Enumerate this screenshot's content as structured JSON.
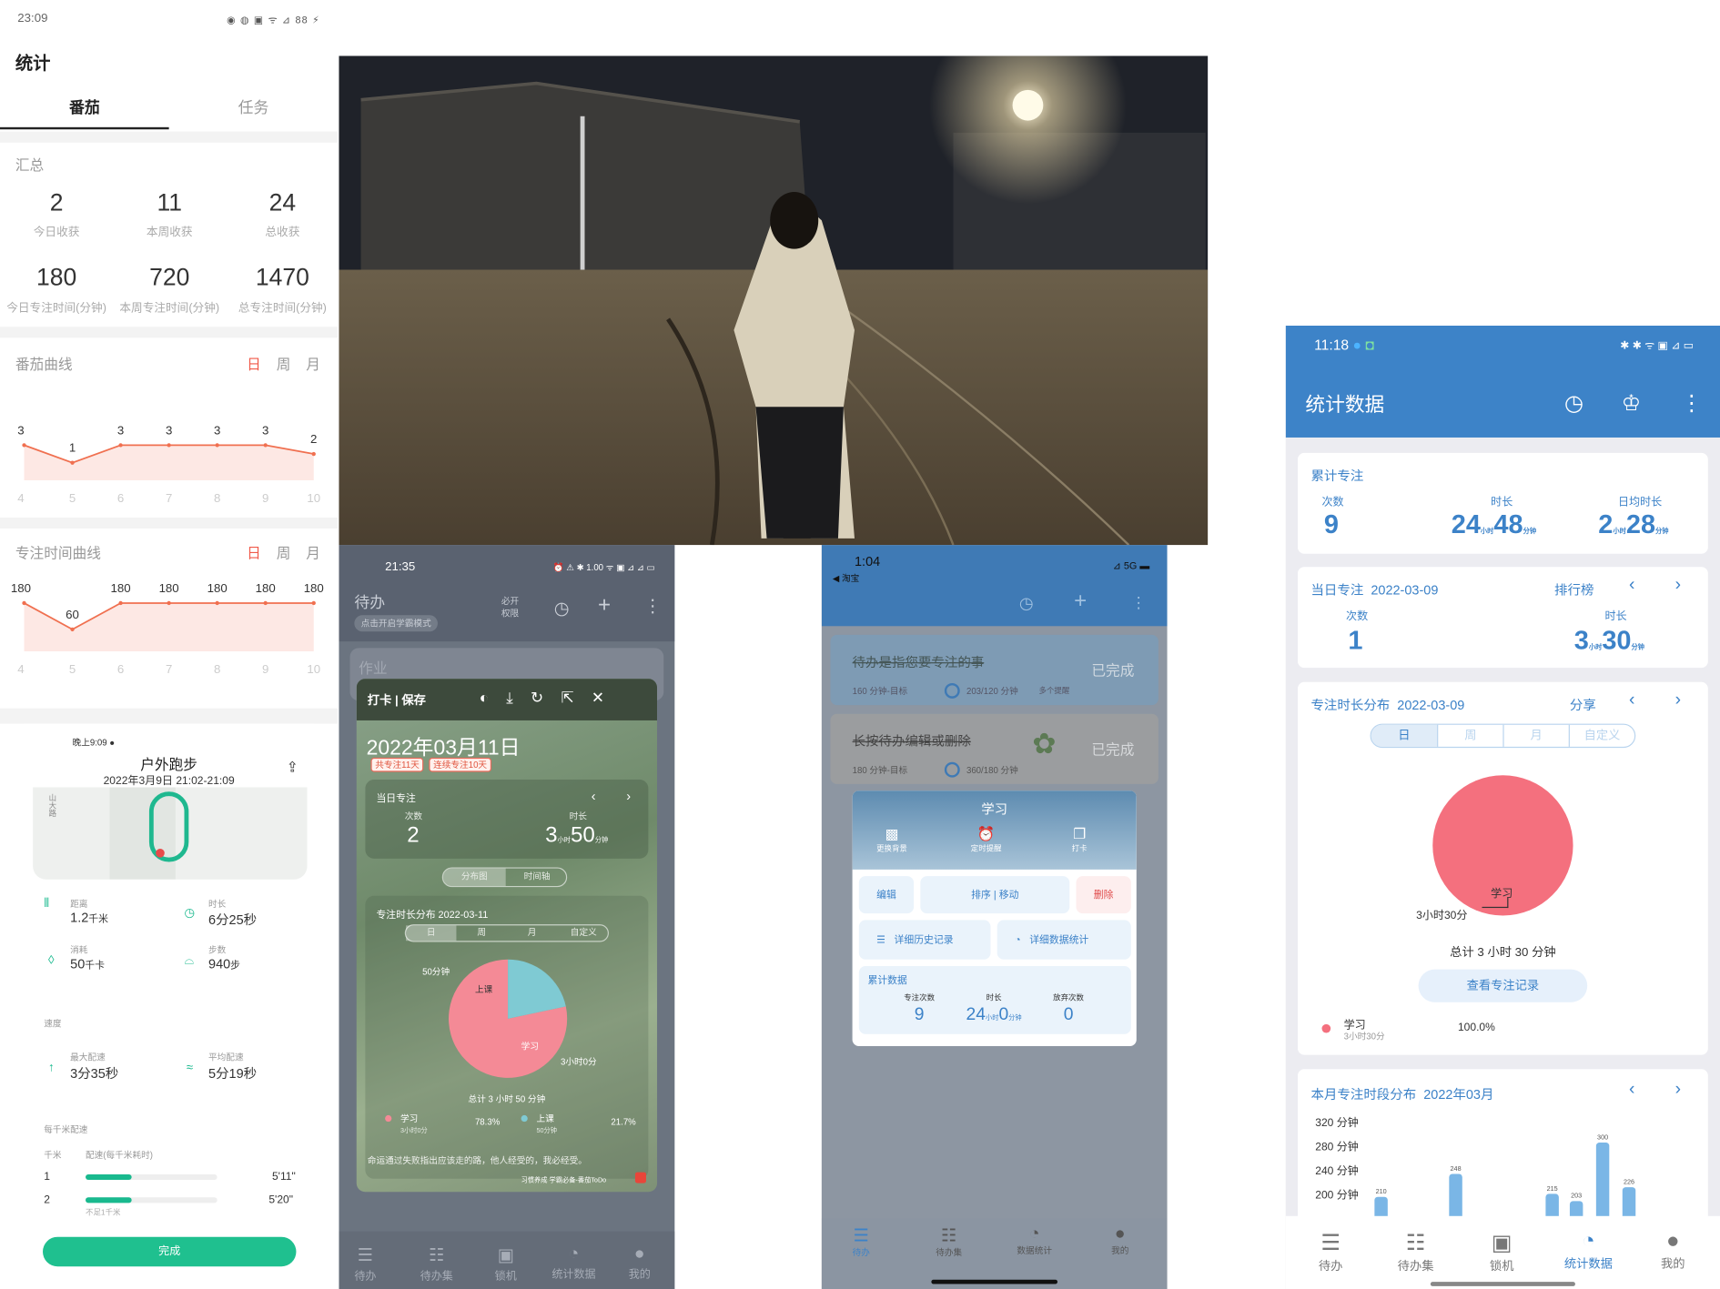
{
  "p1": {
    "time": "23:09",
    "status_icons": "◉ ◍ ▣ ᯤ ⊿ 88 ⚡",
    "title": "统计",
    "tabs": [
      "番茄",
      "任务"
    ],
    "summary_title": "汇总",
    "stats": [
      {
        "v": "2",
        "l": "今日收获"
      },
      {
        "v": "11",
        "l": "本周收获"
      },
      {
        "v": "24",
        "l": "总收获"
      },
      {
        "v": "180",
        "l": "今日专注时间(分钟)"
      },
      {
        "v": "720",
        "l": "本周专注时间(分钟)"
      },
      {
        "v": "1470",
        "l": "总专注时间(分钟)"
      }
    ],
    "curve1_title": "番茄曲线",
    "curve2_title": "专注时间曲线",
    "dwm": [
      "日",
      "周",
      "月"
    ],
    "run": {
      "time": "晚上9:09 ●",
      "title": "户外跑步",
      "date": "2022年3月9日 21:02-21:09",
      "map_label": "山大路",
      "fields": [
        {
          "l": "距离",
          "v": "1.2",
          "u": "千米"
        },
        {
          "l": "时长",
          "v": "6分25秒",
          "u": ""
        },
        {
          "l": "消耗",
          "v": "50",
          "u": "千卡"
        },
        {
          "l": "步数",
          "v": "940",
          "u": "步"
        }
      ],
      "speed_title": "速度",
      "speeds": [
        {
          "l": "最大配速",
          "v": "3分35秒"
        },
        {
          "l": "平均配速",
          "v": "5分19秒"
        }
      ],
      "pace_title": "每千米配速",
      "pace_head": [
        "千米",
        "配速(每千米耗时)"
      ],
      "pace_rows": [
        {
          "k": "1",
          "v": "5'11\""
        },
        {
          "k": "2",
          "v": "5'20\"",
          "note": "不足1千米"
        }
      ],
      "done": "完成"
    }
  },
  "p3": {
    "time": "21:35",
    "status_icons": "⏰ ⚠ ✱ 1.00 ᯤ ▣ ⊿ ⊿ ▭",
    "todo": "待办",
    "hint": "点击开启学霸模式",
    "perm": "必开\n权限",
    "header": "打卡 | 保存",
    "date": "2022年03月11日",
    "badges": [
      "共专注11天",
      "连续专注10天"
    ],
    "today_title": "当日专注",
    "count_label": "次数",
    "dur_label": "时长",
    "count": "2",
    "dur_h": "3",
    "dur_m": "50",
    "unit_h": "小时",
    "unit_m": "分钟",
    "seg": [
      "分布图",
      "时间轴"
    ],
    "dist_title": "专注时长分布 2022-03-11",
    "periods": [
      "日",
      "周",
      "月",
      "自定义"
    ],
    "pie_labels": [
      "50分钟",
      "上课",
      "学习",
      "3小时0分"
    ],
    "total": "总计 3 小时 50 分钟",
    "legend": [
      {
        "n": "学习",
        "d": "3小时0分",
        "p": "78.3%",
        "c": "#f48a96"
      },
      {
        "n": "上课",
        "d": "50分钟",
        "p": "21.7%",
        "c": "#7fcad3"
      }
    ],
    "quote": "命运通过失败指出应该走的路，他人经受的，我必经受。",
    "brand": "习惯养成 学霸必备-番茄ToDo",
    "nav": [
      "待办",
      "待办集",
      "锁机",
      "统计数据",
      "我的"
    ],
    "bg_item": "作业"
  },
  "p4": {
    "time": "1:04",
    "back": "◀ 淘宝",
    "signal": "5G",
    "items": [
      {
        "t": "待办是指您要专注的事",
        "s": "160 分钟-目标",
        "p": "203/120 分钟",
        "x": "多个提醒",
        "d": "已完成"
      },
      {
        "t": "长按待办编辑或删除",
        "s": "180 分钟-目标",
        "p": "360/180 分钟",
        "d": "已完成"
      }
    ],
    "popup_title": "学习",
    "actions": [
      "更换背景",
      "定时提醒",
      "打卡"
    ],
    "btns": [
      "编辑",
      "排序 | 移动",
      "删除"
    ],
    "btns2": [
      "详细历史记录",
      "详细数据统计"
    ],
    "acc_title": "累计数据",
    "acc_labels": [
      "专注次数",
      "时长",
      "放弃次数"
    ],
    "acc_count": "9",
    "acc_h": "24",
    "acc_m": "0",
    "acc_giveup": "0",
    "unit_h": "小时",
    "unit_m": "分钟",
    "nav": [
      "待办",
      "待办集",
      "数据统计",
      "我的"
    ]
  },
  "p5": {
    "time": "11:18",
    "status_icons": "✱ ✱ ᯤ ▣ ⊿ ▭",
    "title": "统计数据",
    "acc": {
      "title": "累计专注",
      "count_label": "次数",
      "dur_label": "时长",
      "avg_label": "日均时长",
      "count": "9",
      "dur_h": "24",
      "dur_m": "48",
      "avg_h": "2",
      "avg_m": "28",
      "unit_h": "小时",
      "unit_m": "分钟"
    },
    "day": {
      "title": "当日专注",
      "date": "2022-03-09",
      "rank": "排行榜",
      "count_label": "次数",
      "dur_label": "时长",
      "count": "1",
      "dur_h": "3",
      "dur_m": "30"
    },
    "dist": {
      "title": "专注时长分布",
      "date": "2022-03-09",
      "share": "分享",
      "periods": [
        "日",
        "周",
        "月",
        "自定义"
      ],
      "pie_label": "学习",
      "pie_value": "3小时30分",
      "total": "总计 3 小时 30 分钟",
      "view": "查看专注记录",
      "legend": "学习",
      "legend_dur": "3小时30分",
      "legend_pct": "100.0%"
    },
    "month": {
      "title": "本月专注时段分布",
      "date": "2022年03月",
      "yticks": [
        "320 分钟",
        "280 分钟",
        "240 分钟",
        "200 分钟"
      ]
    },
    "nav": [
      "待办",
      "待办集",
      "锁机",
      "统计数据",
      "我的"
    ]
  },
  "chart_data": [
    {
      "type": "line",
      "title": "番茄曲线",
      "x": [
        4,
        5,
        6,
        7,
        8,
        9,
        10
      ],
      "values": [
        3,
        1,
        3,
        3,
        3,
        3,
        2
      ],
      "ylim": [
        0,
        3
      ]
    },
    {
      "type": "line",
      "title": "专注时间曲线",
      "x": [
        4,
        5,
        6,
        7,
        8,
        9,
        10
      ],
      "values": [
        180,
        60,
        180,
        180,
        180,
        180,
        180
      ],
      "ylim": [
        0,
        180
      ]
    },
    {
      "type": "pie",
      "title": "专注时长分布 2022-03-11",
      "categories": [
        "学习",
        "上课"
      ],
      "values": [
        78.3,
        21.7
      ],
      "colors": [
        "#f48a96",
        "#7fcad3"
      ]
    },
    {
      "type": "pie",
      "title": "专注时长分布 2022-03-09",
      "categories": [
        "学习"
      ],
      "values": [
        100.0
      ],
      "colors": [
        "#f4707e"
      ]
    },
    {
      "type": "bar",
      "title": "本月专注时段分布",
      "values": [
        210,
        248,
        215,
        203,
        300,
        226
      ],
      "ylim": [
        200,
        320
      ]
    }
  ]
}
